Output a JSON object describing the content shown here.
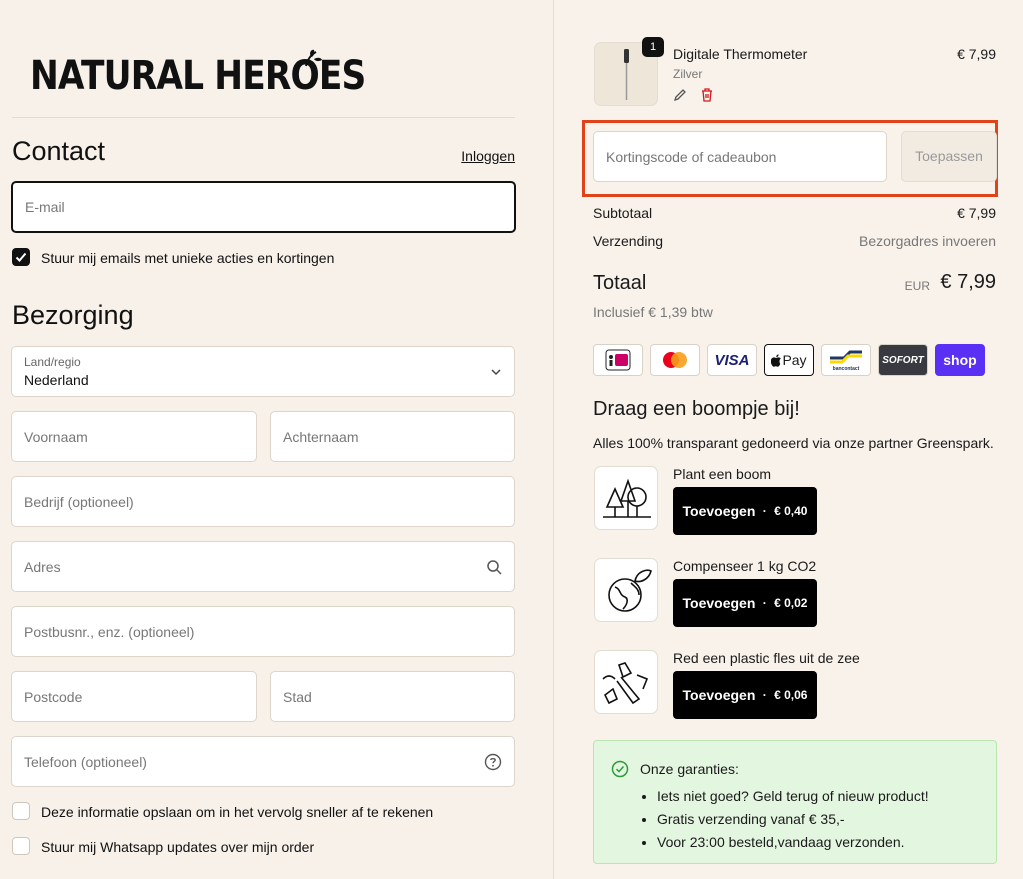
{
  "brand": {
    "logo_text": "NATURAL HEROES"
  },
  "contact": {
    "title": "Contact",
    "login_link": "Inloggen",
    "email_placeholder": "E-mail",
    "newsletter_label": "Stuur mij emails met unieke acties en kortingen",
    "newsletter_checked": true
  },
  "delivery": {
    "title": "Bezorging",
    "country_label": "Land/regio",
    "country_value": "Nederland",
    "first_name": "Voornaam",
    "last_name": "Achternaam",
    "company": "Bedrijf (optioneel)",
    "address": "Adres",
    "address2": "Postbusnr., enz. (optioneel)",
    "postcode": "Postcode",
    "city": "Stad",
    "phone": "Telefoon (optioneel)",
    "save_info_label": "Deze informatie opslaan om in het vervolg sneller af te rekenen",
    "whatsapp_label": "Stuur mij Whatsapp updates over mijn order"
  },
  "cart": {
    "item": {
      "name": "Digitale Thermometer",
      "variant": "Zilver",
      "quantity": "1",
      "price": "€ 7,99"
    },
    "discount_placeholder": "Kortingscode of cadeaubon",
    "apply_button": "Toepassen",
    "subtotal_label": "Subtotaal",
    "subtotal_value": "€ 7,99",
    "shipping_label": "Verzending",
    "shipping_value": "Bezorgadres invoeren",
    "total_label": "Totaal",
    "currency": "EUR",
    "total_value": "€ 7,99",
    "tax_note": "Inclusief € 1,39 btw"
  },
  "payment_methods": [
    "iDEAL",
    "Mastercard",
    "VISA",
    "Apple Pay",
    "Bancontact",
    "SOFORT",
    "shop"
  ],
  "donate": {
    "title": "Draag een boompje bij!",
    "subtitle": "Alles 100% transparant gedoneerd via onze partner Greenspark.",
    "button_label": "Toevoegen",
    "items": [
      {
        "title": "Plant een boom",
        "amount": "€ 0,40",
        "icon": "trees-icon"
      },
      {
        "title": "Compenseer 1 kg CO2",
        "amount": "€ 0,02",
        "icon": "globe-leaf-icon"
      },
      {
        "title": "Red een plastic fles uit de zee",
        "amount": "€ 0,06",
        "icon": "plastic-bottle-icon"
      }
    ]
  },
  "guarantees": {
    "title": "Onze garanties:",
    "items": [
      "Iets niet goed? Geld terug of nieuw product!",
      "Gratis verzending vanaf € 35,-",
      "Voor 23:00 besteld,vandaag verzonden."
    ]
  },
  "colors": {
    "highlight": "#e0431a",
    "shop_pay": "#5a31f4",
    "guarantee_bg": "#e3f6e0"
  }
}
